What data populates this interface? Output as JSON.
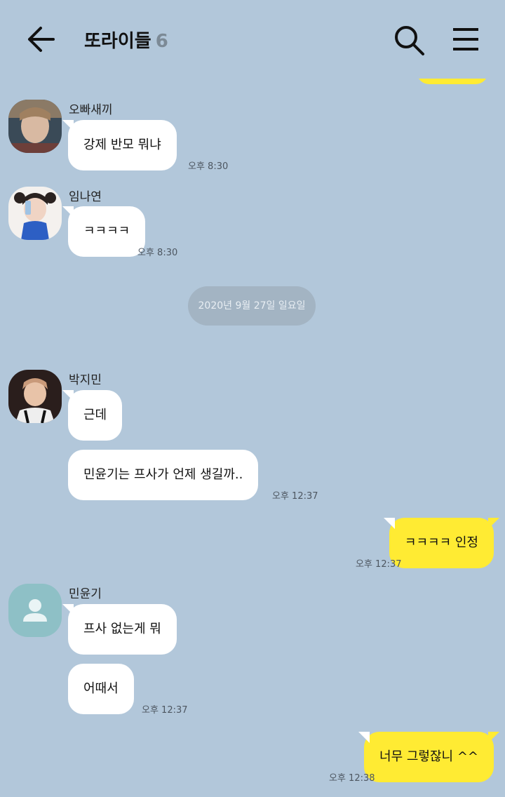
{
  "header": {
    "title": "또라이들",
    "member_count": "6"
  },
  "messages": [
    {
      "sender": "오빠새끼",
      "text": "강제 반모 뭐냐",
      "time": "오후 8:30"
    },
    {
      "sender": "임나연",
      "text": "ㅋㅋㅋㅋ",
      "time": "오후 8:30"
    },
    {
      "date": "2020년 9월 27일 일요일"
    },
    {
      "sender": "박지민",
      "texts": [
        "근데",
        "민윤기는 프사가 언제 생길까.."
      ],
      "time": "오후 12:37"
    },
    {
      "sender": "me",
      "text": "ㅋㅋㅋㅋ 인정",
      "time": "오후 12:37"
    },
    {
      "sender": "민윤기",
      "texts": [
        "프사 없는게 뭐",
        "어때서"
      ],
      "time": "오후 12:37"
    },
    {
      "sender": "me",
      "text": "너무 그렇잖니 ^^",
      "time": "오후 12:38"
    }
  ],
  "colors": {
    "background": "#b2c7da",
    "my_bubble": "#ffeb33",
    "other_bubble": "#ffffff",
    "date_pill": "#a3b4c3"
  },
  "icons": [
    "back-arrow-icon",
    "search-icon",
    "menu-icon",
    "default-profile-icon"
  ]
}
